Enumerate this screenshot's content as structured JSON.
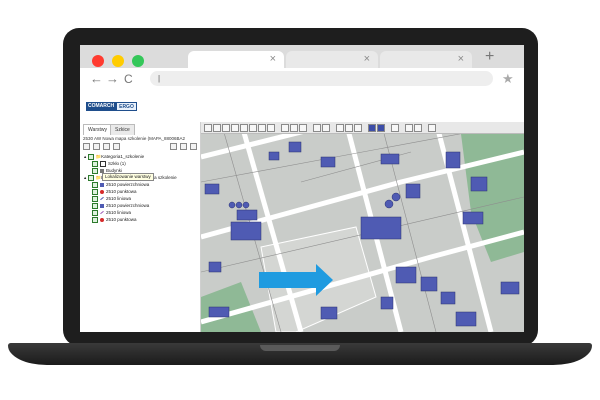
{
  "browser": {
    "tabs": [
      {
        "close": "×"
      },
      {
        "close": "×"
      },
      {
        "close": "×"
      }
    ],
    "new_tab": "+",
    "nav": {
      "back": "←",
      "forward": "→",
      "reload": "C"
    },
    "url": "|",
    "bookmark": "★"
  },
  "app": {
    "logo_part1": "COMARCH",
    "logo_part2": "ERGO"
  },
  "left_panel": {
    "tabs": [
      "Warstwy",
      "Szkice"
    ],
    "map_title": "2530 AW Nowa mapa szkolenie (MAPA_88006BA2",
    "tree": [
      {
        "label": "Kategoria1_szkolenie",
        "indent": 0
      },
      {
        "label": "Szkło (1)",
        "indent": 1
      },
      {
        "label": "Budynki",
        "indent": 1
      },
      {
        "label": "Lokalizowanie warstwy ... ia szkolenie",
        "indent": 0
      },
      {
        "label": "2510 powierzchniowa",
        "indent": 1
      },
      {
        "label": "2510 punktowa",
        "indent": 1
      },
      {
        "label": "2510 liniowa",
        "indent": 1
      },
      {
        "label": "2510 powierzchniowa",
        "indent": 1
      },
      {
        "label": "2510 liniowa",
        "indent": 1
      },
      {
        "label": "2510 punktowa",
        "indent": 1
      }
    ],
    "tooltip": "Lokalizowanie warstwy"
  },
  "colors": {
    "building": "#4f5bb3",
    "land": "#c9ccc9",
    "green": "#8fb996",
    "road": "#ffffff",
    "arrow": "#1f9be0"
  }
}
